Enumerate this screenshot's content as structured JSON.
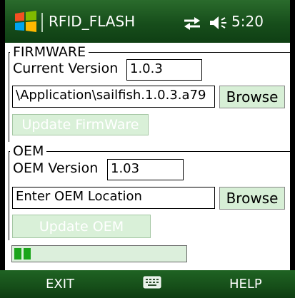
{
  "status_bar": {
    "app_title": "RFID_FLASH",
    "time": "5:20",
    "icons": [
      "windows-start-icon",
      "sync-arrows-icon",
      "volume-icon"
    ]
  },
  "firmware": {
    "legend": "FIRMWARE",
    "current_version_label": "Current Version",
    "current_version_value": "1.0.3",
    "path_value": "\\Application\\sailfish.1.0.3.a79",
    "browse_label": "Browse",
    "update_label": "Update FirmWare"
  },
  "oem": {
    "legend": "OEM",
    "version_label": "OEM Version",
    "version_value": "1.03",
    "location_value": "Enter OEM Location",
    "browse_label": "Browse",
    "update_label": "Update OEM"
  },
  "progress": {
    "blocks_filled": 2
  },
  "softkeys": {
    "left": "EXIT",
    "right": "HELP",
    "center_icon": "keyboard-icon"
  },
  "colors": {
    "bar_green": "#174e1b",
    "button_green": "#d7efd6",
    "progress_fill": "#1ca51c"
  }
}
